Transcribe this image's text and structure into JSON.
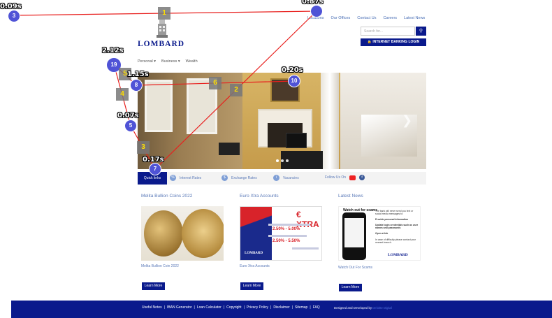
{
  "header": {
    "top_links": [
      "Locations",
      "Our Offices",
      "Contact Us",
      "Careers",
      "Latest News"
    ],
    "search_placeholder": "Search for...",
    "search_icon": "search-icon",
    "internet_banking_label": "INTERNET BANKING LOGIN",
    "logo_text": "LOMBARD"
  },
  "nav": {
    "items": [
      "Personal ▾",
      "Business ▾",
      "Wealth"
    ]
  },
  "hero": {
    "next_arrow": "❯"
  },
  "quicklinks": {
    "label": "Quick links",
    "items": [
      {
        "label": "Interest Rates",
        "icon": "percent-icon"
      },
      {
        "label": "Exchange Rates",
        "icon": "exchange-icon"
      },
      {
        "label": "Vacancies",
        "icon": "briefcase-icon"
      }
    ],
    "follow_label": "Follow Us On"
  },
  "columns": [
    {
      "title": "Melita Bullion Coins 2022",
      "caption": "Melita Bullion Coin 2022",
      "button": "Learn More"
    },
    {
      "title": "Euro Xtra Accounts",
      "caption": "Euro Xtra Accounts",
      "button": "Learn More",
      "ad": {
        "title": "€ XTRA",
        "rate1": "2.50% - 5.00%",
        "rate2": "2.50% - 5.50%",
        "brand": "LOMBARD"
      }
    },
    {
      "title": "Latest News",
      "caption": "Watch Out For Scams",
      "button": "Learn More",
      "ad": {
        "heading": "Watch out for scams",
        "lines": [
          "The bank will never send you text or social media messages to:",
          "Provide personal information",
          "Update login credentials such as user names and passwords",
          "Open a link",
          "In case of difficulty please contact your nearest branch."
        ],
        "brand": "LOMBARD"
      }
    }
  ],
  "footer": {
    "links": [
      "Useful Notes",
      "IBAN Generator",
      "Loan Calculator",
      "Copyright",
      "Privacy Policy",
      "Disclaimer",
      "Sitemap",
      "FAQ"
    ],
    "credit_prefix": "Designed and Developed by",
    "credit_brand": "Deloitte Digital"
  },
  "overlay": {
    "time_labels": [
      "0.09s",
      "0.87s",
      "2.12s",
      "1.15s",
      "0.20s",
      "0.07s",
      "0.17s"
    ],
    "markers": [
      "3",
      "19",
      "8",
      "10",
      "5",
      "7"
    ],
    "steps": [
      "1",
      "2",
      "3",
      "4",
      "5",
      "6"
    ]
  }
}
